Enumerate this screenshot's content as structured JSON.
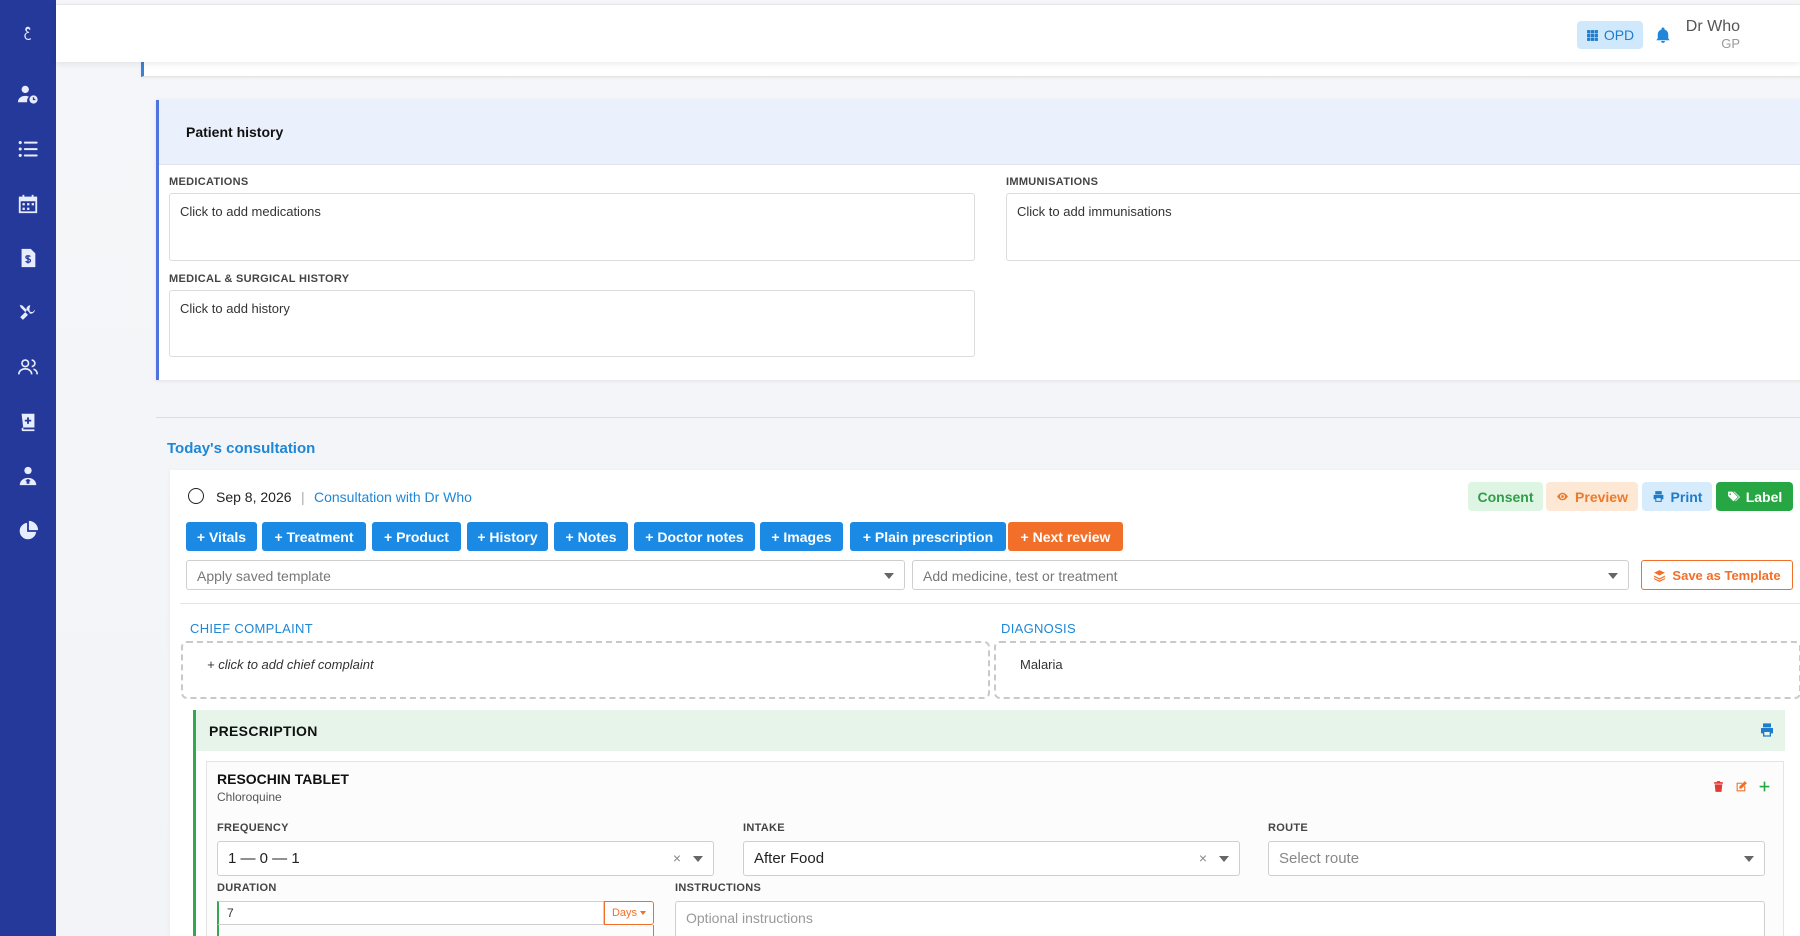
{
  "header": {
    "opd_label": "OPD",
    "user_name": "Dr Who",
    "user_role": "GP"
  },
  "sidebar": {
    "icons": [
      "logo-icon",
      "add-patient-icon",
      "list-icon",
      "calendar-icon",
      "invoice-icon",
      "tools-icon",
      "users-icon",
      "medical-book-icon",
      "staff-icon",
      "pie-chart-icon"
    ]
  },
  "patient_history": {
    "title": "Patient history",
    "medications_label": "MEDICATIONS",
    "medications_placeholder": "Click to add medications",
    "immunisations_label": "IMMUNISATIONS",
    "immunisations_placeholder": "Click to add immunisations",
    "history_label": "MEDICAL & SURGICAL HISTORY",
    "history_placeholder": "Click to add history"
  },
  "consultation": {
    "section_title": "Today's consultation",
    "date": "Sep 8, 2026",
    "separator": "|",
    "title": "Consultation with Dr Who",
    "top_buttons": {
      "consent": "Consent",
      "preview": "Preview",
      "print": "Print",
      "label": "Label"
    },
    "action_buttons": [
      "+ Vitals",
      "+ Treatment",
      "+ Product",
      "+ History",
      "+ Notes",
      "+ Doctor notes",
      "+ Images",
      "+ Plain prescription",
      "+ Next review"
    ],
    "template_placeholder": "Apply saved template",
    "add_item_placeholder": "Add medicine, test or treatment",
    "save_template_label": "Save as Template",
    "chief_complaint_label": "CHIEF COMPLAINT",
    "chief_complaint_placeholder": "+ click to add chief complaint",
    "diagnosis_label": "DIAGNOSIS",
    "diagnosis_value": "Malaria"
  },
  "prescription": {
    "title": "PRESCRIPTION",
    "drug_name": "RESOCHIN TABLET",
    "drug_generic": "Chloroquine",
    "frequency_label": "FREQUENCY",
    "frequency_value": "1 — 0 — 1",
    "intake_label": "INTAKE",
    "intake_value": "After Food",
    "route_label": "ROUTE",
    "route_placeholder": "Select route",
    "duration_label": "DURATION",
    "duration_value": "7",
    "duration_unit": "Days",
    "instructions_label": "INSTRUCTIONS",
    "instructions_placeholder": "Optional instructions",
    "clear_symbol": "×"
  },
  "colors": {
    "sidebar": "#24399a",
    "primary": "#1a8ae5",
    "orange": "#f26f2a",
    "green": "#27a744"
  }
}
